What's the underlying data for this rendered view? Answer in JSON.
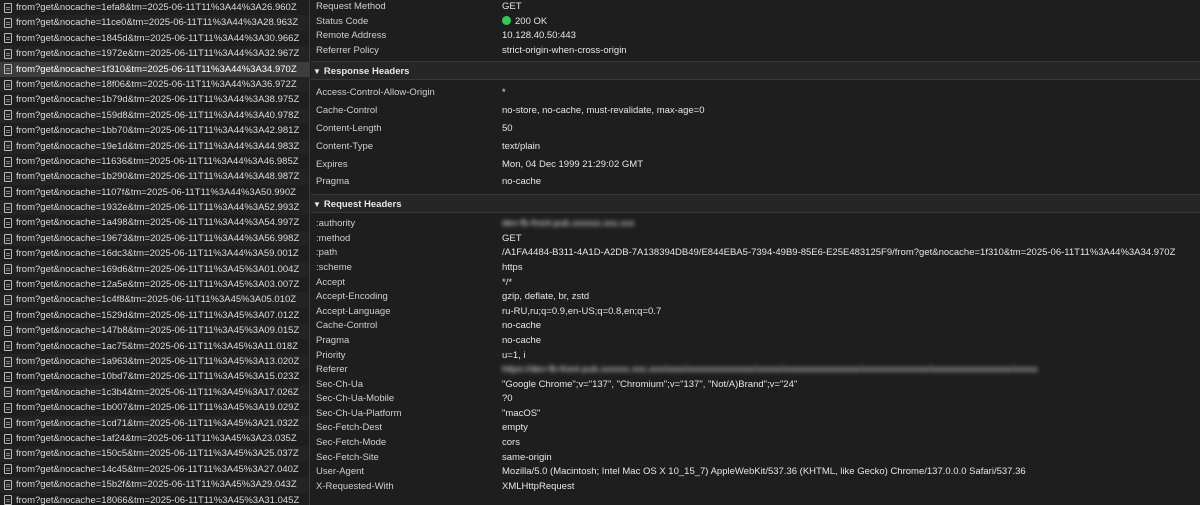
{
  "requests": [
    "from?get&nocache=1efa8&tm=2025-06-11T11%3A44%3A26.960Z",
    "from?get&nocache=11ce0&tm=2025-06-11T11%3A44%3A28.963Z",
    "from?get&nocache=1845d&tm=2025-06-11T11%3A44%3A30.966Z",
    "from?get&nocache=1972e&tm=2025-06-11T11%3A44%3A32.967Z",
    "from?get&nocache=1f310&tm=2025-06-11T11%3A44%3A34.970Z",
    "from?get&nocache=18f06&tm=2025-06-11T11%3A44%3A36.972Z",
    "from?get&nocache=1b79d&tm=2025-06-11T11%3A44%3A38.975Z",
    "from?get&nocache=159d8&tm=2025-06-11T11%3A44%3A40.978Z",
    "from?get&nocache=1bb70&tm=2025-06-11T11%3A44%3A42.981Z",
    "from?get&nocache=19e1d&tm=2025-06-11T11%3A44%3A44.983Z",
    "from?get&nocache=11636&tm=2025-06-11T11%3A44%3A46.985Z",
    "from?get&nocache=1b290&tm=2025-06-11T11%3A44%3A48.987Z",
    "from?get&nocache=1107f&tm=2025-06-11T11%3A44%3A50.990Z",
    "from?get&nocache=1932e&tm=2025-06-11T11%3A44%3A52.993Z",
    "from?get&nocache=1a498&tm=2025-06-11T11%3A44%3A54.997Z",
    "from?get&nocache=19673&tm=2025-06-11T11%3A44%3A56.998Z",
    "from?get&nocache=16dc3&tm=2025-06-11T11%3A44%3A59.001Z",
    "from?get&nocache=169d6&tm=2025-06-11T11%3A45%3A01.004Z",
    "from?get&nocache=12a5e&tm=2025-06-11T11%3A45%3A03.007Z",
    "from?get&nocache=1c4f8&tm=2025-06-11T11%3A45%3A05.010Z",
    "from?get&nocache=1529d&tm=2025-06-11T11%3A45%3A07.012Z",
    "from?get&nocache=147b8&tm=2025-06-11T11%3A45%3A09.015Z",
    "from?get&nocache=1ac75&tm=2025-06-11T11%3A45%3A11.018Z",
    "from?get&nocache=1a963&tm=2025-06-11T11%3A45%3A13.020Z",
    "from?get&nocache=10bd7&tm=2025-06-11T11%3A45%3A15.023Z",
    "from?get&nocache=1c3b4&tm=2025-06-11T11%3A45%3A17.026Z",
    "from?get&nocache=1b007&tm=2025-06-11T11%3A45%3A19.029Z",
    "from?get&nocache=1cd71&tm=2025-06-11T11%3A45%3A21.032Z",
    "from?get&nocache=1af24&tm=2025-06-11T11%3A45%3A23.035Z",
    "from?get&nocache=150c5&tm=2025-06-11T11%3A45%3A25.037Z",
    "from?get&nocache=14c45&tm=2025-06-11T11%3A45%3A27.040Z",
    "from?get&nocache=15b2f&tm=2025-06-11T11%3A45%3A29.043Z",
    "from?get&nocache=18066&tm=2025-06-11T11%3A45%3A31.045Z"
  ],
  "selected_index": 4,
  "general": {
    "request_method": {
      "key": "Request Method",
      "value": "GET"
    },
    "status_code": {
      "key": "Status Code",
      "value": "200 OK",
      "dot_color": "#35c759"
    },
    "remote_address": {
      "key": "Remote Address",
      "value": "10.128.40.50:443"
    },
    "referrer_policy": {
      "key": "Referrer Policy",
      "value": "strict-origin-when-cross-origin"
    }
  },
  "response_headers": {
    "title": "Response Headers",
    "rows": [
      {
        "key": "Access-Control-Allow-Origin",
        "value": "*"
      },
      {
        "key": "Cache-Control",
        "value": "no-store, no-cache, must-revalidate, max-age=0"
      },
      {
        "key": "Content-Length",
        "value": "50"
      },
      {
        "key": "Content-Type",
        "value": "text/plain"
      },
      {
        "key": "Expires",
        "value": "Mon, 04 Dec 1999 21:29:02 GMT"
      },
      {
        "key": "Pragma",
        "value": "no-cache"
      }
    ]
  },
  "request_headers": {
    "title": "Request Headers",
    "rows": [
      {
        "key": ":authority",
        "value": "dev-fb-front-pub.xxxxxx.xxx.xxx",
        "blurred": true
      },
      {
        "key": ":method",
        "value": "GET"
      },
      {
        "key": ":path",
        "value": "/A1FA4484-B311-4A1D-A2DB-7A138394DB49/E844EBA5-7394-49B9-85E6-E25E483125F9/from?get&nocache=1f310&tm=2025-06-11T11%3A44%3A34.970Z"
      },
      {
        "key": ":scheme",
        "value": "https"
      },
      {
        "key": "Accept",
        "value": "*/*"
      },
      {
        "key": "Accept-Encoding",
        "value": "gzip, deflate, br, zstd"
      },
      {
        "key": "Accept-Language",
        "value": "ru-RU,ru;q=0.9,en-US;q=0.8,en;q=0.7"
      },
      {
        "key": "Cache-Control",
        "value": "no-cache"
      },
      {
        "key": "Pragma",
        "value": "no-cache"
      },
      {
        "key": "Priority",
        "value": "u=1, i"
      },
      {
        "key": "Referer",
        "value": "https://dev-fb-front-pub.xxxxxx.xxx.xxx/xxxx/xxxxxxxxxxxxxx/xxxxx/xxxxxxxxxxxxxxxx/xxxxxxxxxxxxxx/xxxxxxxxxxxxxxxxx/xxxxx",
        "blurred": true
      },
      {
        "key": "Sec-Ch-Ua",
        "value": "\"Google Chrome\";v=\"137\", \"Chromium\";v=\"137\", \"Not/A)Brand\";v=\"24\""
      },
      {
        "key": "Sec-Ch-Ua-Mobile",
        "value": "?0"
      },
      {
        "key": "Sec-Ch-Ua-Platform",
        "value": "\"macOS\""
      },
      {
        "key": "Sec-Fetch-Dest",
        "value": "empty"
      },
      {
        "key": "Sec-Fetch-Mode",
        "value": "cors"
      },
      {
        "key": "Sec-Fetch-Site",
        "value": "same-origin"
      },
      {
        "key": "User-Agent",
        "value": "Mozilla/5.0 (Macintosh; Intel Mac OS X 10_15_7) AppleWebKit/537.36 (KHTML, like Gecko) Chrome/137.0.0.0 Safari/537.36"
      },
      {
        "key": "X-Requested-With",
        "value": "XMLHttpRequest"
      }
    ]
  }
}
